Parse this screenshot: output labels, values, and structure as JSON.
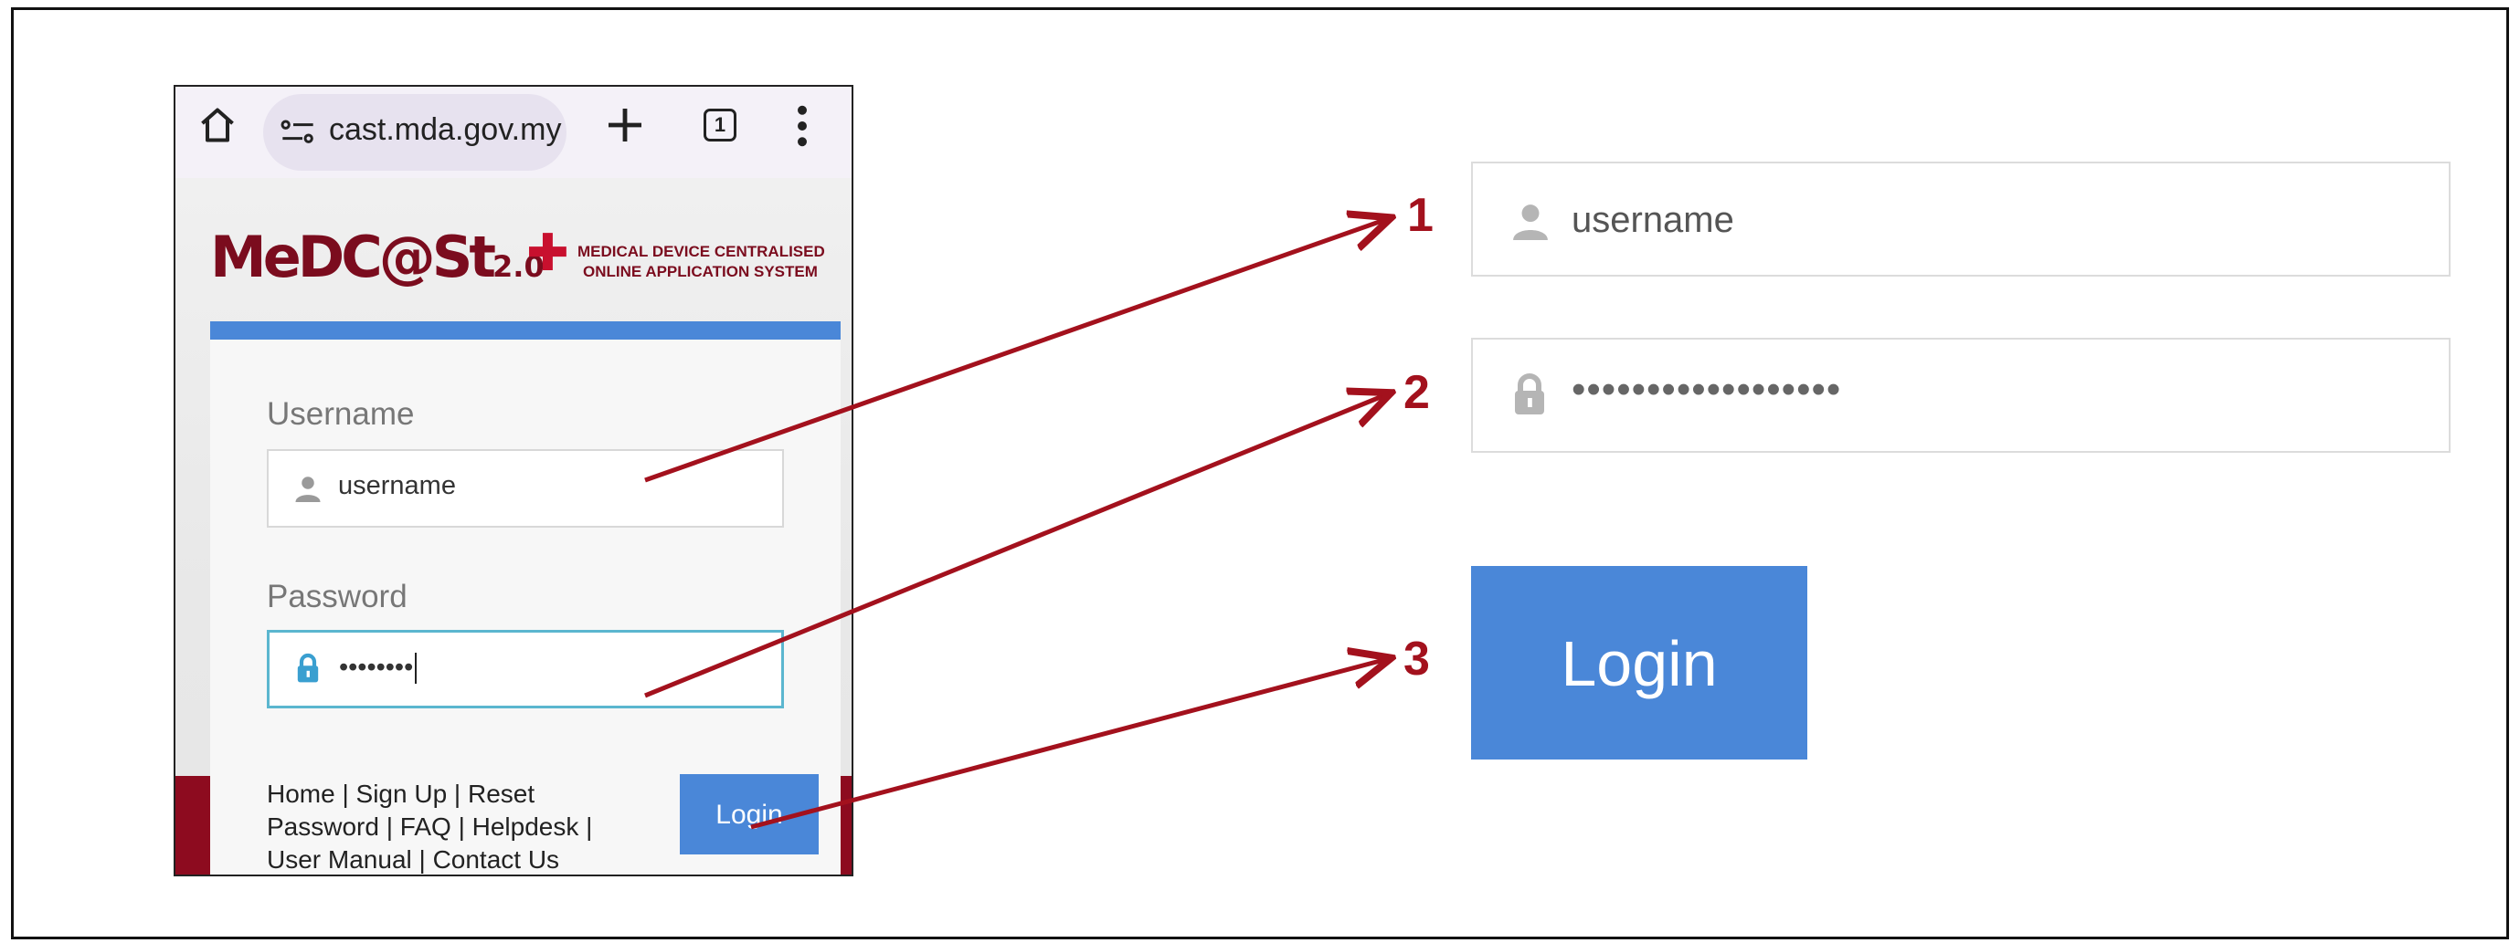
{
  "browser": {
    "url": "cast.mda.gov.my",
    "tab_count": "1"
  },
  "logo": {
    "wordmark": "MeDC@St",
    "version": "2.0",
    "tagline_line1": "MEDICAL DEVICE CENTRALISED",
    "tagline_line2": "ONLINE APPLICATION SYSTEM"
  },
  "login_form": {
    "username_label": "Username",
    "username_value": "username",
    "password_label": "Password",
    "password_value": "••••••••",
    "footer_links": "Home | Sign Up | Reset Password | FAQ | Helpdesk | User Manual | Contact Us",
    "login_label": "Login"
  },
  "zoomed": {
    "username_value": "username",
    "password_value": "••••••••••••••••••",
    "login_label": "Login"
  },
  "callouts": {
    "one": "1",
    "two": "2",
    "three": "3"
  },
  "colors": {
    "accent_blue": "#4a87d8",
    "brand_maroon": "#8d0b1f",
    "callout_red": "#a3111d",
    "focus_teal": "#5bb6cf"
  },
  "icons": [
    "home-icon",
    "tune-icon",
    "plus-icon",
    "tabs-icon",
    "more-vert-icon",
    "user-icon",
    "lock-icon",
    "arrow-icon"
  ]
}
